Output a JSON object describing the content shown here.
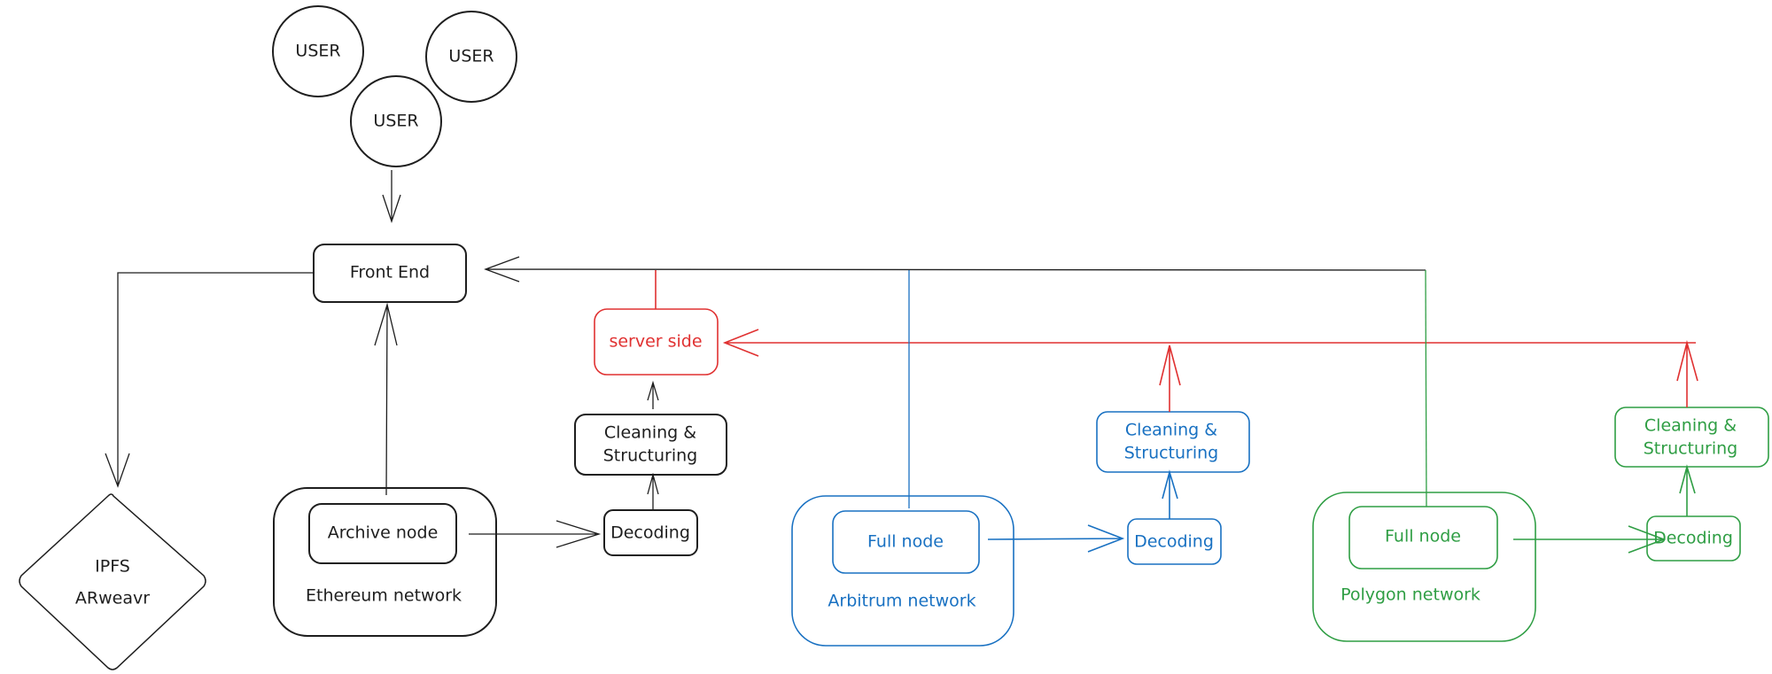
{
  "colors": {
    "black": "#1e1e1e",
    "red": "#e03131",
    "blue": "#1971c2",
    "green": "#2f9e44"
  },
  "users": [
    "USER",
    "USER",
    "USER"
  ],
  "front_end": "Front End",
  "storage": {
    "line1": "IPFS",
    "line2": "ARweavr"
  },
  "server_side": "server side",
  "ethereum": {
    "network": "Ethereum network",
    "node": "Archive node",
    "decoding": "Decoding",
    "cleaning1": "Cleaning &",
    "cleaning2": "Structuring"
  },
  "arbitrum": {
    "network": "Arbitrum network",
    "node": "Full node",
    "decoding": "Decoding",
    "cleaning1": "Cleaning &",
    "cleaning2": "Structuring"
  },
  "polygon": {
    "network": "Polygon network",
    "node": "Full node",
    "decoding": "Decoding",
    "cleaning1": "Cleaning &",
    "cleaning2": "Structuring"
  }
}
